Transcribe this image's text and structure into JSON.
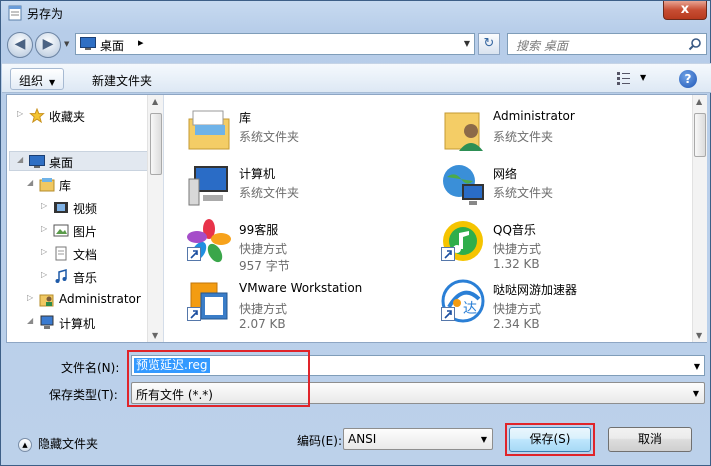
{
  "window": {
    "title": "另存为",
    "close_label": "x"
  },
  "address": {
    "path": "桌面",
    "search_placeholder": "搜索 桌面"
  },
  "toolbar": {
    "organize_label": "组织",
    "new_folder_label": "新建文件夹",
    "help_label": "?"
  },
  "sidebar": {
    "items": [
      {
        "label": "收藏夹",
        "icon": "star-icon"
      },
      {
        "label": "桌面",
        "icon": "desktop-icon",
        "selected": true
      },
      {
        "label": "库",
        "icon": "library-icon"
      },
      {
        "label": "视频",
        "icon": "video-icon"
      },
      {
        "label": "图片",
        "icon": "picture-icon"
      },
      {
        "label": "文档",
        "icon": "document-icon"
      },
      {
        "label": "音乐",
        "icon": "music-icon"
      },
      {
        "label": "Administrator",
        "icon": "user-folder-icon"
      },
      {
        "label": "计算机",
        "icon": "computer-icon"
      }
    ]
  },
  "files": [
    {
      "name": "库",
      "type": "系统文件夹",
      "size": "",
      "icon": "library-icon"
    },
    {
      "name": "Administrator",
      "type": "系统文件夹",
      "size": "",
      "icon": "user-folder-icon"
    },
    {
      "name": "计算机",
      "type": "系统文件夹",
      "size": "",
      "icon": "computer-icon"
    },
    {
      "name": "网络",
      "type": "系统文件夹",
      "size": "",
      "icon": "network-icon"
    },
    {
      "name": "99客服",
      "type": "快捷方式",
      "size": "957 字节",
      "icon": "pinwheel-icon"
    },
    {
      "name": "QQ音乐",
      "type": "快捷方式",
      "size": "1.32 KB",
      "icon": "qq-music-icon"
    },
    {
      "name": "VMware Workstation",
      "type": "快捷方式",
      "size": "2.07 KB",
      "icon": "vmware-icon"
    },
    {
      "name": "哒哒网游加速器",
      "type": "快捷方式",
      "size": "2.34 KB",
      "icon": "dada-accelerator-icon"
    }
  ],
  "form": {
    "filename_label": "文件名(N):",
    "filename_value": "预览延迟.reg",
    "filetype_label": "保存类型(T):",
    "filetype_value": "所有文件 (*.*)",
    "hide_folders_label": "隐藏文件夹",
    "encoding_label": "编码(E):",
    "encoding_value": "ANSI",
    "save_label": "保存(S)",
    "cancel_label": "取消"
  },
  "colors": {
    "highlight_red": "#e0242a",
    "selection_blue": "#3399ff"
  }
}
